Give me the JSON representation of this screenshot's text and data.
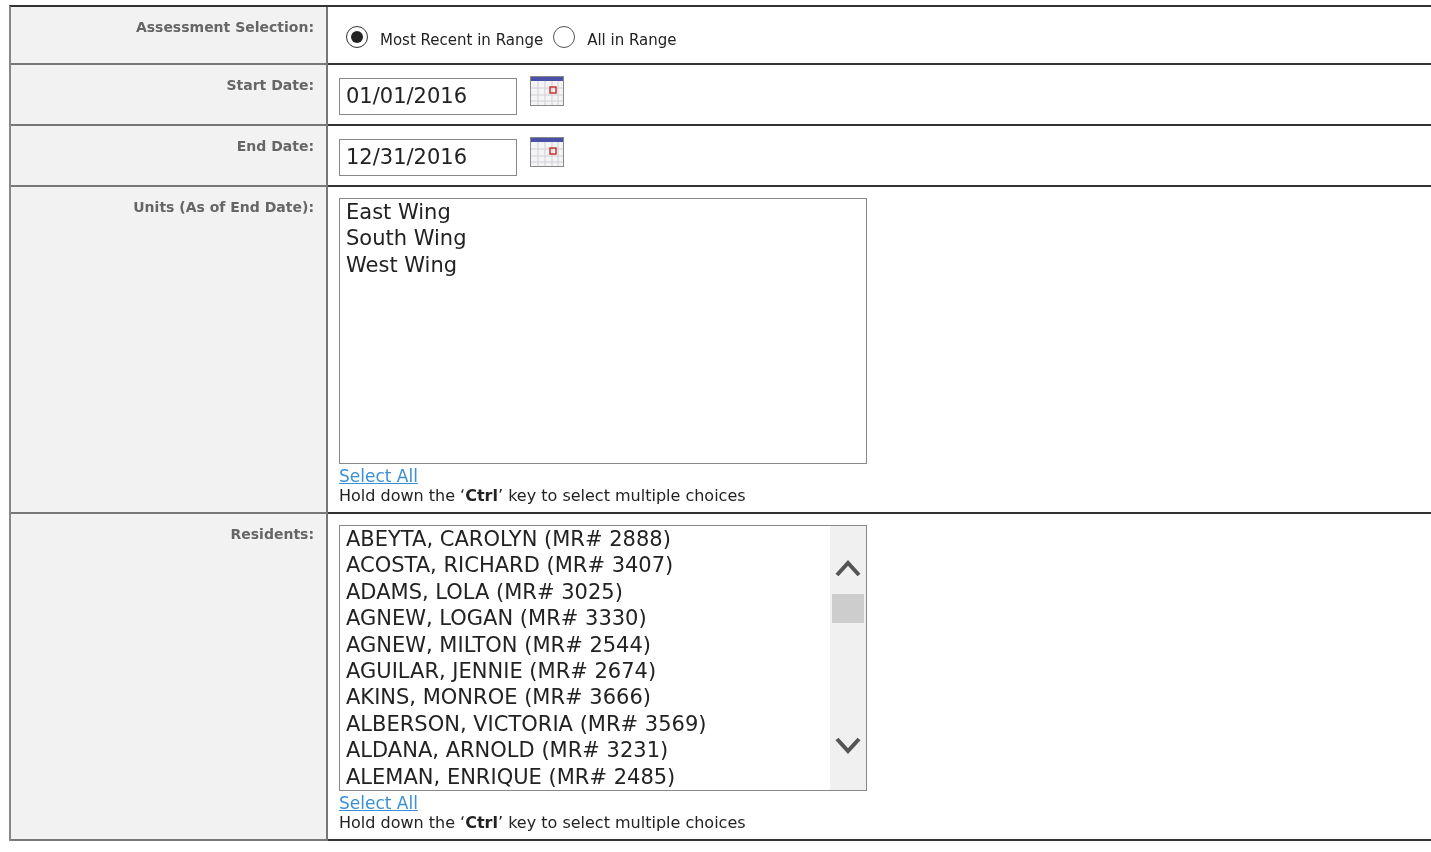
{
  "rows": [
    {
      "kind": "radio",
      "label": "Assessment Selection:",
      "options": [
        {
          "label": "Most Recent in Range",
          "selected": true
        },
        {
          "label": "All in Range",
          "selected": false
        }
      ]
    },
    {
      "kind": "date",
      "label": "Start Date:",
      "value": "01/01/2016"
    },
    {
      "kind": "date",
      "label": "End Date:",
      "value": "12/31/2016"
    },
    {
      "kind": "listbox",
      "label": "Units (As of End Date):",
      "scrollbar": false,
      "items": [
        "East Wing",
        "South Wing",
        "West Wing"
      ],
      "link": "Select All",
      "hint": "Hold down the ‘**Ctrl**’ key to select multiple choices"
    },
    {
      "kind": "listbox",
      "label": "Residents:",
      "scrollbar": true,
      "items": [
        "ABEYTA, CAROLYN (MR# 2888)",
        "ACOSTA, RICHARD (MR# 3407)",
        "ADAMS, LOLA (MR# 3025)",
        "AGNEW, LOGAN (MR# 3330)",
        "AGNEW, MILTON (MR# 2544)",
        "AGUILAR, JENNIE (MR# 2674)",
        "AKINS, MONROE (MR# 3666)",
        "ALBERSON, VICTORIA (MR# 3569)",
        "ALDANA, ARNOLD (MR# 3231)",
        "ALEMAN, ENRIQUE (MR# 2485)"
      ],
      "link": "Select All",
      "hint": "Hold down the ‘**Ctrl**’ key to select multiple choices"
    }
  ]
}
